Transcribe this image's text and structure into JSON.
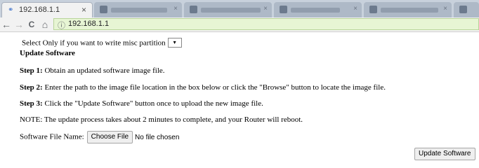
{
  "browser": {
    "active_tab_title": "192.168.1.1",
    "close_glyph": "×",
    "url": "192.168.1.1",
    "info_glyph": "ⓘ",
    "nav": {
      "back": "←",
      "forward": "→",
      "reload": "C",
      "home": "⌂"
    }
  },
  "page": {
    "misc_partition_label": "Select Only if you want to write misc partition",
    "select_arrow": "▾",
    "heading": "Update Software",
    "steps": [
      {
        "label": "Step 1:",
        "text": "Obtain an updated software image file."
      },
      {
        "label": "Step 2:",
        "text": "Enter the path to the image file location in the box below or click the \"Browse\" button to locate the image file."
      },
      {
        "label": "Step 3:",
        "text": "Click the \"Update Software\" button once to upload the new image file."
      }
    ],
    "note": "NOTE: The update process takes about 2 minutes to complete, and your Router will reboot.",
    "file_label": "Software File Name:",
    "choose_file_button": "Choose File",
    "no_file_text": "No file chosen",
    "submit_button": "Update Software"
  }
}
